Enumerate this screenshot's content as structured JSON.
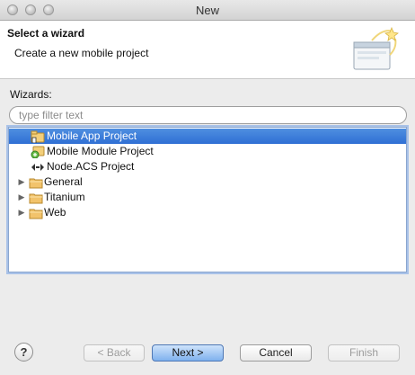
{
  "window": {
    "title": "New"
  },
  "header": {
    "title": "Select a wizard",
    "description": "Create a new mobile project"
  },
  "wizards_label": "Wizards:",
  "filter": {
    "placeholder": "type filter text",
    "value": ""
  },
  "tree": {
    "items": [
      {
        "label": "Mobile App Project",
        "icon": "mobile-app-project-icon",
        "selected": true,
        "expandable": false
      },
      {
        "label": "Mobile Module Project",
        "icon": "mobile-module-project-icon",
        "selected": false,
        "expandable": false
      },
      {
        "label": "Node.ACS Project",
        "icon": "node-acs-project-icon",
        "selected": false,
        "expandable": false
      },
      {
        "label": "General",
        "icon": "folder-icon",
        "selected": false,
        "expandable": true
      },
      {
        "label": "Titanium",
        "icon": "folder-icon",
        "selected": false,
        "expandable": true
      },
      {
        "label": "Web",
        "icon": "folder-icon",
        "selected": false,
        "expandable": true
      }
    ]
  },
  "buttons": {
    "help": "?",
    "back": "< Back",
    "next": "Next >",
    "cancel": "Cancel",
    "finish": "Finish"
  },
  "colors": {
    "selection": "#3b7fdc",
    "folder": "#f2c36b",
    "default_button": "#7fb1ee"
  }
}
